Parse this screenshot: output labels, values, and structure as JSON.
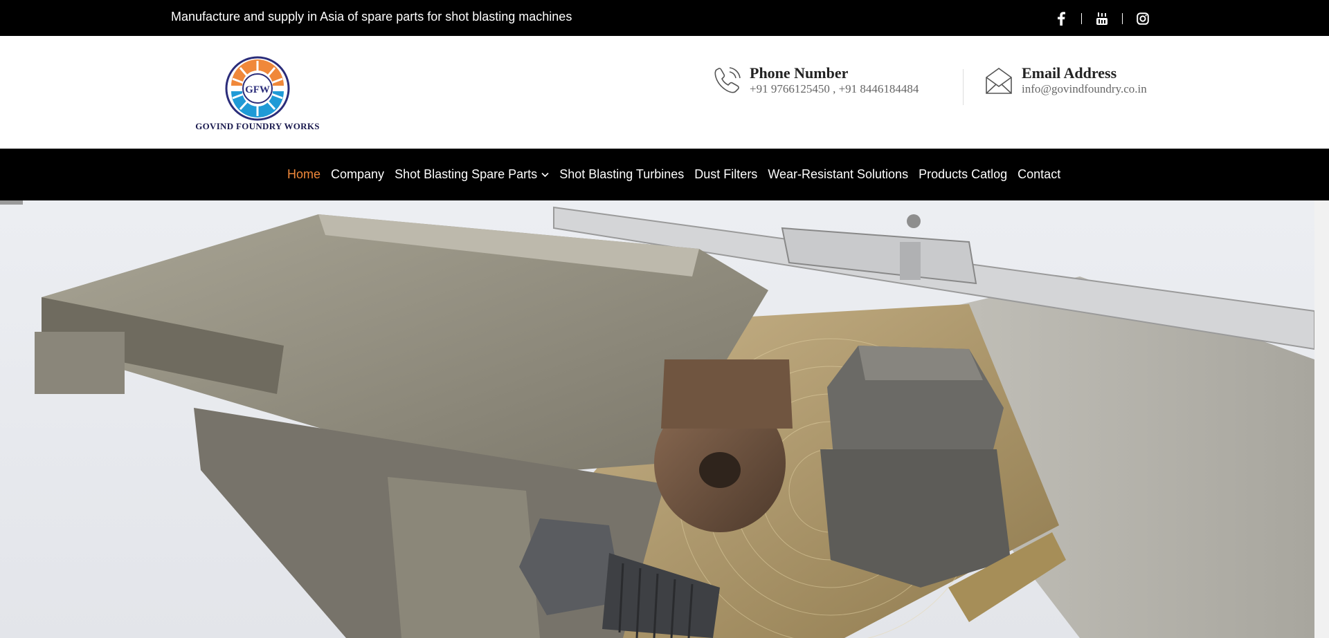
{
  "topbar": {
    "tagline": "Manufacture and supply in Asia of spare parts for shot blasting machines",
    "social": [
      {
        "icon": "facebook-icon"
      },
      {
        "icon": "youtube-icon"
      },
      {
        "icon": "instagram-icon"
      }
    ]
  },
  "logo": {
    "emblem_text": "GFW",
    "company_name": "GOVIND FOUNDRY WORKS"
  },
  "contact": {
    "phone": {
      "title": "Phone Number",
      "value": "+91 9766125450 , +91 8446184484",
      "icon": "phone-icon"
    },
    "email": {
      "title": "Email Address",
      "value": "info@govindfoundry.co.in",
      "icon": "envelope-icon"
    }
  },
  "nav": {
    "items": [
      {
        "label": "Home",
        "active": true
      },
      {
        "label": "Company"
      },
      {
        "label": "Shot Blasting Spare Parts",
        "has_dropdown": true
      },
      {
        "label": "Shot Blasting Turbines"
      },
      {
        "label": "Dust Filters"
      },
      {
        "label": "Wear-Resistant Solutions"
      },
      {
        "label": "Products Catlog"
      },
      {
        "label": "Contact"
      }
    ]
  },
  "colors": {
    "bar_background": "#000000",
    "active_nav": "#f0883a",
    "logo_orange": "#f0883a",
    "logo_blue": "#1f9ad6",
    "logo_navy": "#2b2d7a"
  }
}
